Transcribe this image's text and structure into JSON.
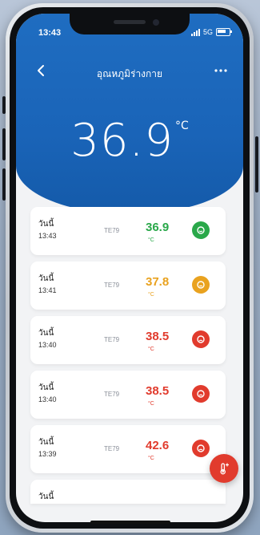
{
  "status_bar": {
    "time": "13:43",
    "network": "5G"
  },
  "nav": {
    "back_icon": "chevron-left-icon",
    "title": "อุณหภูมิร่างกาย",
    "more_icon": "more-horizontal-icon"
  },
  "current": {
    "value": "36.9",
    "unit": "°C"
  },
  "colors": {
    "header_blue": "#1a64b8",
    "normal": "#2aa84a",
    "warning": "#e9a21f",
    "fever": "#e13b2d"
  },
  "readings": [
    {
      "day": "วันนี้",
      "time": "13:43",
      "device": "TE79",
      "value": "36.9",
      "unit": "°C",
      "status": "normal",
      "color": "#2aa84a"
    },
    {
      "day": "วันนี้",
      "time": "13:41",
      "device": "TE79",
      "value": "37.8",
      "unit": "°C",
      "status": "warning",
      "color": "#e9a21f"
    },
    {
      "day": "วันนี้",
      "time": "13:40",
      "device": "TE79",
      "value": "38.5",
      "unit": "°C",
      "status": "fever",
      "color": "#e13b2d"
    },
    {
      "day": "วันนี้",
      "time": "13:40",
      "device": "TE79",
      "value": "38.5",
      "unit": "°C",
      "status": "fever",
      "color": "#e13b2d"
    },
    {
      "day": "วันนี้",
      "time": "13:39",
      "device": "TE79",
      "value": "42.6",
      "unit": "°C",
      "status": "fever",
      "color": "#e13b2d"
    },
    {
      "day": "วันนี้"
    }
  ],
  "fab": {
    "icon": "add-thermometer-icon"
  }
}
